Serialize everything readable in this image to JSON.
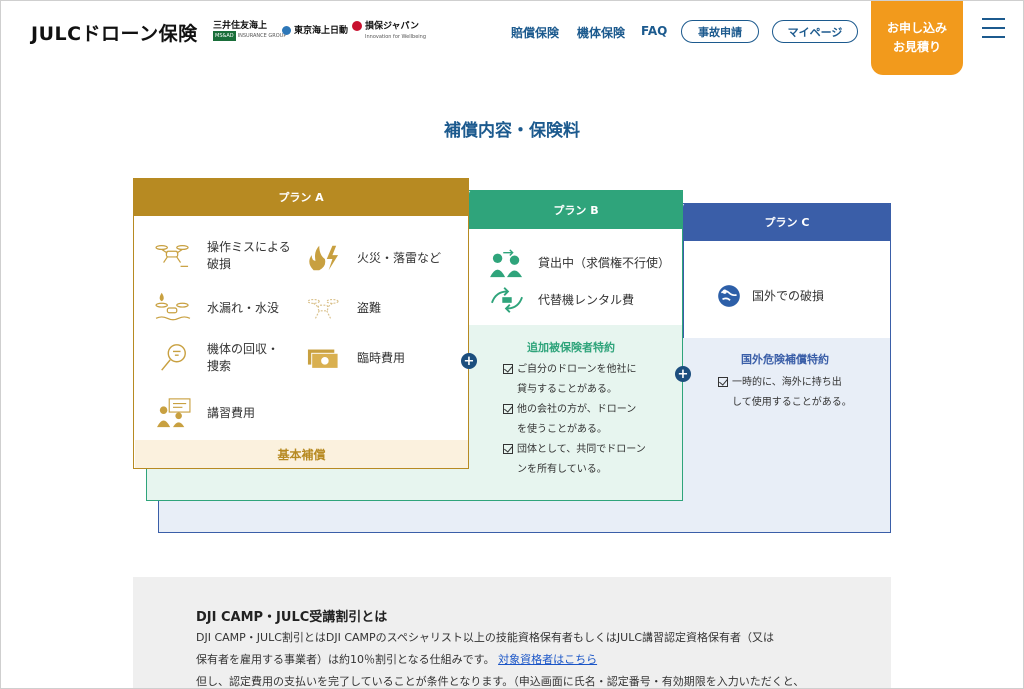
{
  "header": {
    "logo": "JULCドローン保険",
    "partners": [
      {
        "name": "三井住友海上",
        "badge": "MS&AD",
        "sub": "INSURANCE GROUP"
      },
      {
        "name": "東京海上日動"
      },
      {
        "name": "損保ジャパン",
        "sub": "Innovation for Wellbeing"
      }
    ],
    "nav": [
      "賠償保険",
      "機体保険",
      "FAQ"
    ],
    "pills": [
      "事故申請",
      "マイページ"
    ],
    "cta": {
      "line1": "お申し込み",
      "line2": "お見積り"
    }
  },
  "section_title": "補償内容・保険料",
  "plan_a": {
    "label": "プラン A",
    "items": [
      {
        "text": "操作ミスによる\n破損",
        "icon": "drone-crash-icon"
      },
      {
        "text": "火災・落雷など",
        "icon": "fire-lightning-icon"
      },
      {
        "text": "水漏れ・水没",
        "icon": "drone-water-icon"
      },
      {
        "text": "盗難",
        "icon": "theft-icon"
      },
      {
        "text": "機体の回収・\n捜索",
        "icon": "magnifier-icon"
      },
      {
        "text": "臨時費用",
        "icon": "money-icon"
      },
      {
        "text": "講習費用",
        "icon": "lecture-icon"
      }
    ],
    "footer": "基本補償"
  },
  "plan_b": {
    "label": "プラン B",
    "items": [
      {
        "text": "貸出中（求償権不行使）",
        "icon": "lending-icon"
      },
      {
        "text": "代替機レンタル費",
        "icon": "rental-icon"
      }
    ],
    "rider_title": "追加被保険者特約",
    "rider_items": [
      [
        "ご自分のドローンを他社に",
        "貸与することがある。"
      ],
      [
        "他の会社の方が、ドローン",
        "を使うことがある。"
      ],
      [
        "団体として、共同でドローン",
        "ンを所有している。"
      ]
    ]
  },
  "plan_c": {
    "label": "プラン C",
    "items": [
      {
        "text": "国外での破損",
        "icon": "globe-icon"
      }
    ],
    "rider_title": "国外危険補償特約",
    "rider_items": [
      [
        "一時的に、海外に持ち出",
        "して使用することがある。"
      ]
    ]
  },
  "plus_symbol": "+",
  "discount": {
    "title": "DJI CAMP・JULC受講割引とは",
    "line1": "DJI CAMP・JULC割引とはDJI CAMPのスペシャリスト以上の技能資格保有者もしくはJULC講習認定資格保有者（又は",
    "line2_pre": "保有者を雇用する事業者）は約10％割引となる仕組みです。",
    "line2_link": "対象資格者はこちら",
    "line3": "但し、認定費用の支払いを完了していることが条件となります。（申込画面に氏名・認定番号・有効期限を入力いただくと、"
  },
  "colors": {
    "brand_blue": "#1c5a8e",
    "cta_orange": "#f29a1c",
    "plan_a": "#b78a22",
    "plan_b": "#2fa47b",
    "plan_c": "#3a5ea8"
  }
}
